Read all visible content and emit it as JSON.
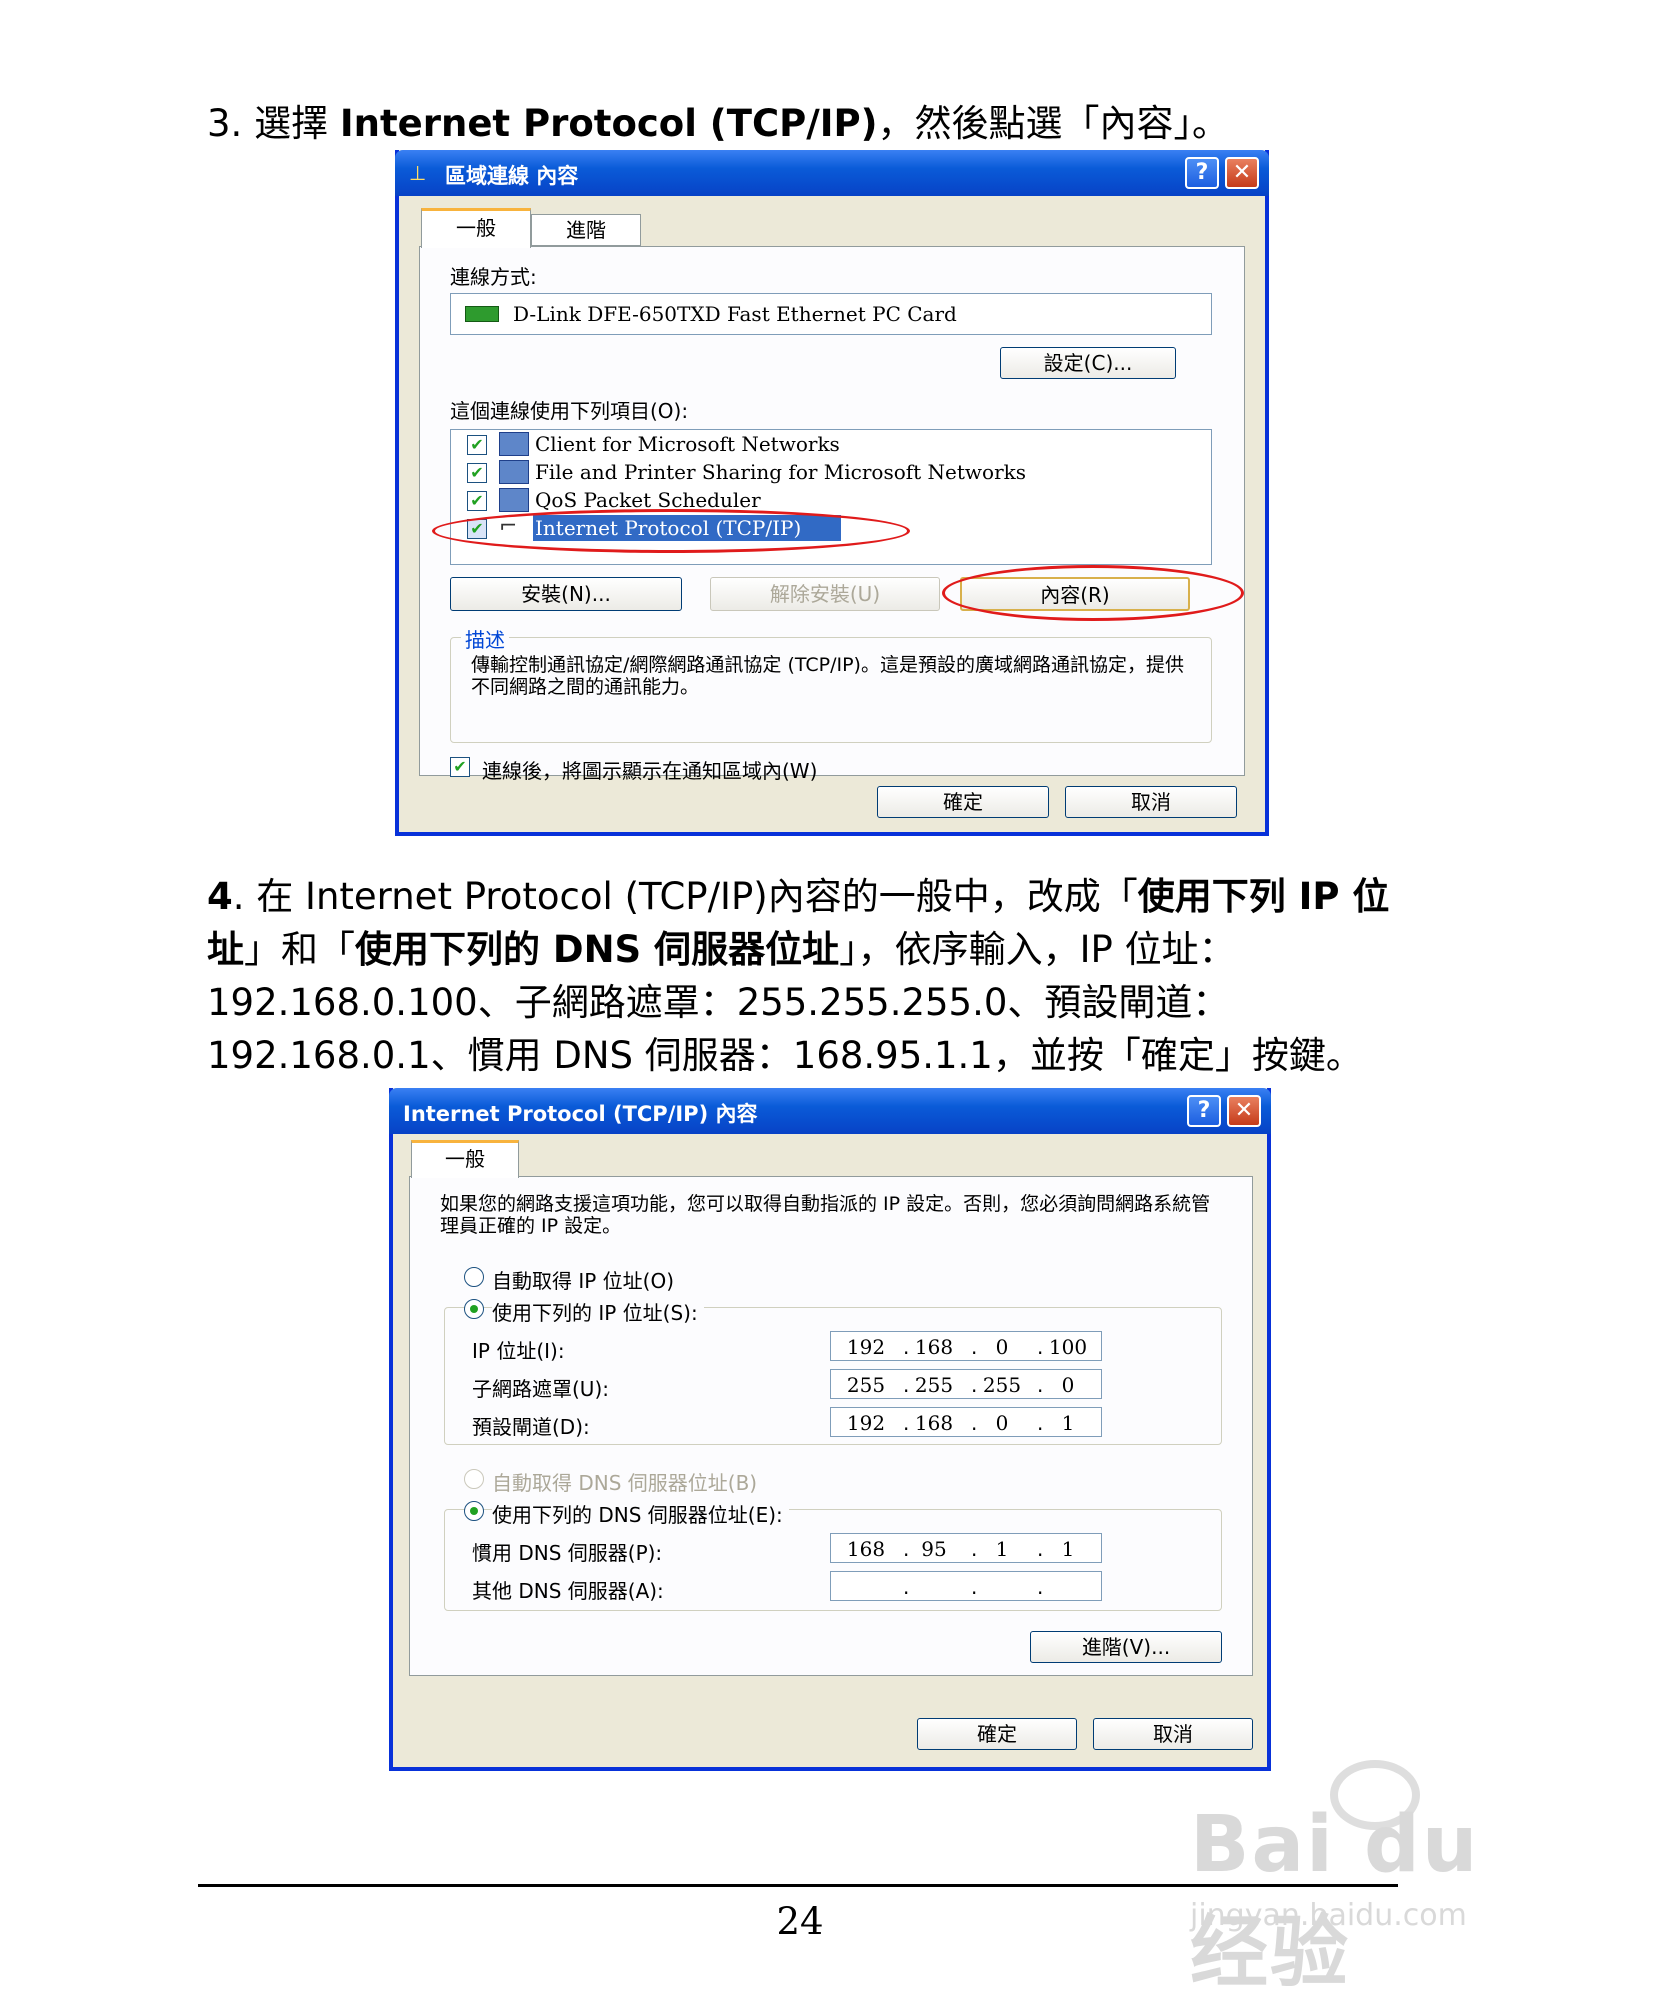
{
  "step3": {
    "num": "3. ",
    "pre": "選擇 ",
    "bold": "Internet Protocol (TCP/IP)",
    "post": "，然後點選「內容」。"
  },
  "dialog1": {
    "title": "區域連線 內容",
    "tabs": [
      "一般",
      "進階"
    ],
    "connect_using_label": "連線方式:",
    "adapter": "D-Link DFE-650TXD Fast Ethernet PC Card",
    "configure_button": "設定(C)...",
    "items_label": "這個連線使用下列項目(O):",
    "items": [
      "Client for Microsoft Networks",
      "File and Printer Sharing for Microsoft Networks",
      "QoS Packet Scheduler",
      "Internet Protocol (TCP/IP)"
    ],
    "install_button": "安裝(N)...",
    "uninstall_button": "解除安裝(U)",
    "properties_button": "內容(R)",
    "description_legend": "描述",
    "description": "傳輸控制通訊協定/網際網路通訊協定 (TCP/IP)。這是預設的廣域網路通訊協定，提供不同網路之間的通訊能力。",
    "show_icon_label": "連線後，將圖示顯示在通知區域內(W)",
    "ok_button": "確定",
    "cancel_button": "取消"
  },
  "step4": {
    "num": "4",
    "t1": ". 在 Internet Protocol (TCP/IP)內容的一般中，改成「",
    "b1": "使用下列 IP 位址",
    "t2": "」和「",
    "b2": "使用下列的 DNS 伺服器位址",
    "t3": "」，依序輸入，IP 位址：192.168.0.100、子網路遮罩：255.255.255.0、預設閘道：192.168.0.1、慣用 DNS 伺服器：168.95.1.1，並按「確定」按鍵。"
  },
  "dialog2": {
    "title": "Internet Protocol (TCP/IP) 內容",
    "tab": "一般",
    "intro": "如果您的網路支援這項功能，您可以取得自動指派的 IP 設定。否則，您必須詢問網路系統管理員正確的 IP 設定。",
    "auto_ip": "自動取得 IP 位址(O)",
    "use_ip": "使用下列的 IP 位址(S):",
    "ip_label": "IP 位址(I):",
    "mask_label": "子網路遮罩(U):",
    "gw_label": "預設閘道(D):",
    "ip": [
      "192",
      "168",
      "0",
      "100"
    ],
    "mask": [
      "255",
      "255",
      "255",
      "0"
    ],
    "gw": [
      "192",
      "168",
      "0",
      "1"
    ],
    "auto_dns": "自動取得 DNS 伺服器位址(B)",
    "use_dns": "使用下列的 DNS 伺服器位址(E):",
    "pref_dns_label": "慣用 DNS 伺服器(P):",
    "alt_dns_label": "其他 DNS 伺服器(A):",
    "pref_dns": [
      "168",
      "95",
      "1",
      "1"
    ],
    "alt_dns": [
      "",
      "",
      "",
      ""
    ],
    "advanced_button": "進階(V)...",
    "ok_button": "確定",
    "cancel_button": "取消"
  },
  "page_number": "24",
  "watermark": {
    "logo": "Bai du 经验",
    "url": "jingyan.baidu.com"
  }
}
